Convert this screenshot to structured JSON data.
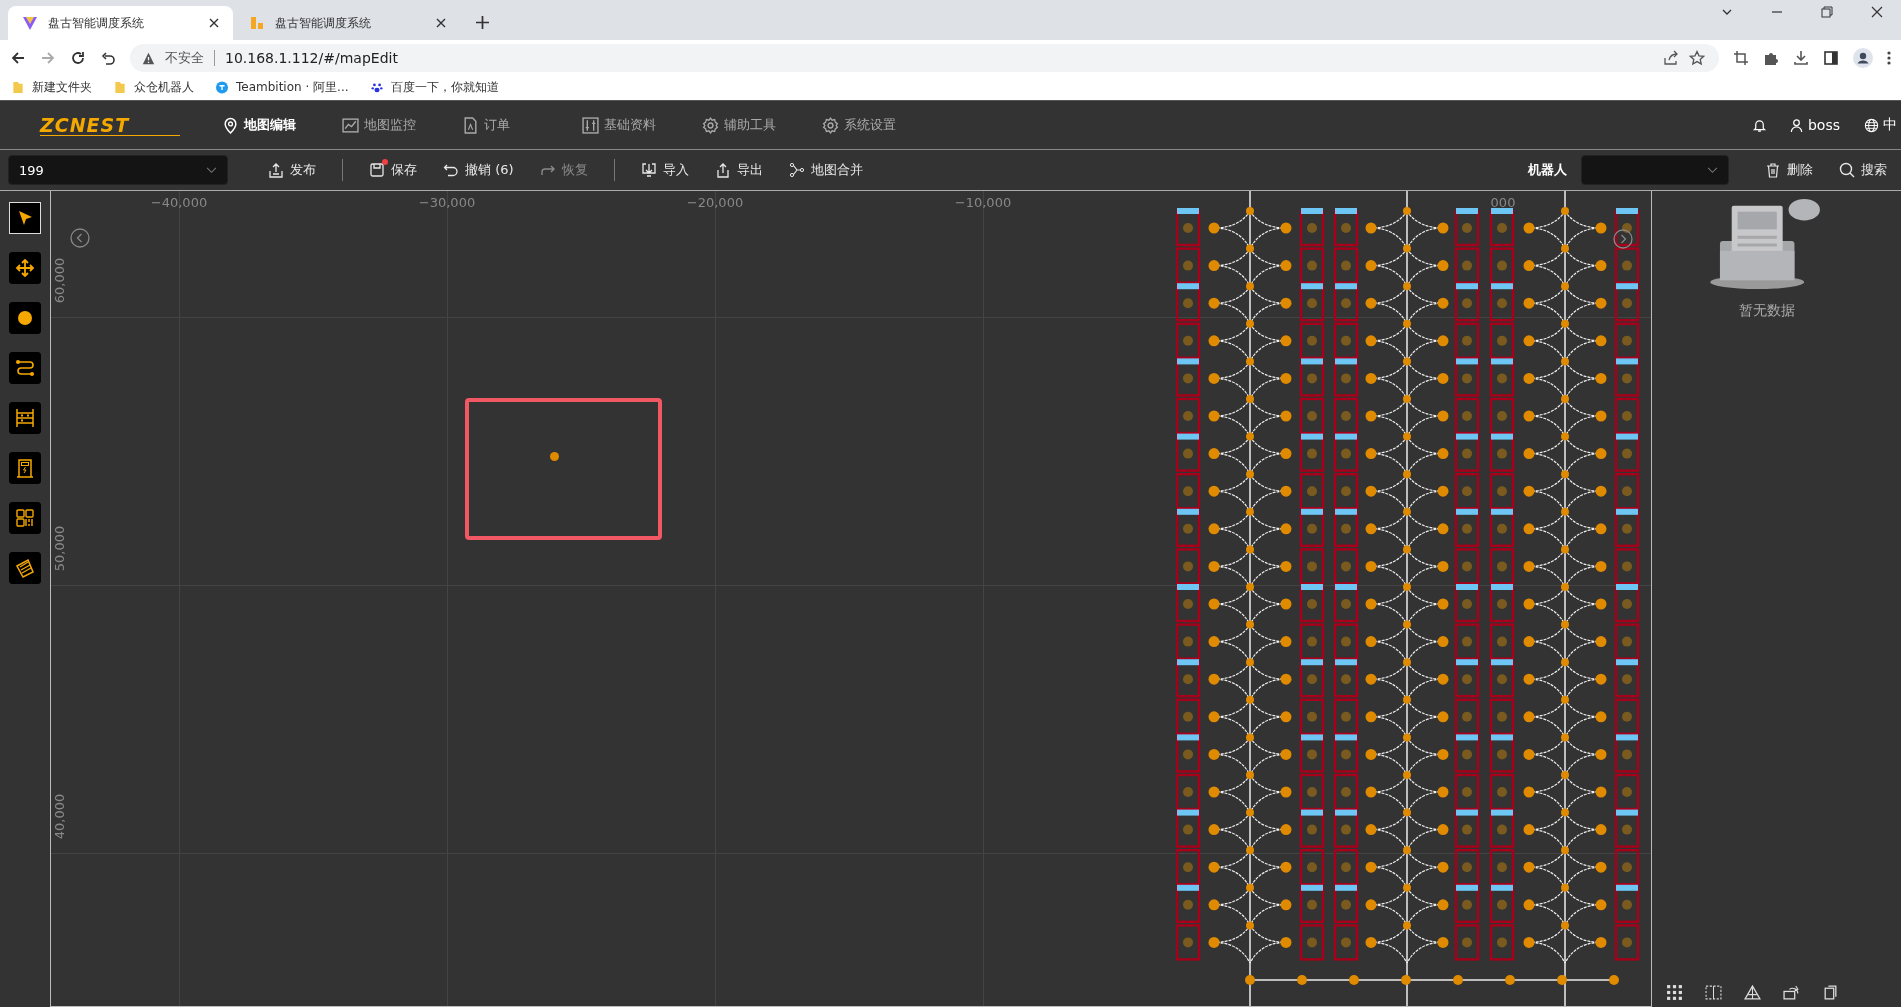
{
  "browser": {
    "tabs": [
      {
        "title": "盘古智能调度系统",
        "selected": true
      },
      {
        "title": "盘古智能调度系统",
        "selected": false
      }
    ],
    "address": {
      "security": "不安全",
      "url": "10.168.1.112/#/mapEdit"
    },
    "bookmarks": [
      "新建文件夹",
      "众仓机器人",
      "Teambition · 阿里...",
      "百度一下，你就知道"
    ]
  },
  "header": {
    "logo": "ZCNEST",
    "nav": [
      {
        "label": "地图编辑",
        "selected": true
      },
      {
        "label": "地图监控",
        "selected": false
      },
      {
        "label": "订单",
        "selected": false
      },
      {
        "label": "基础资料",
        "selected": false
      },
      {
        "label": "辅助工具",
        "selected": false
      },
      {
        "label": "系统设置",
        "selected": false
      }
    ],
    "user": "boss",
    "language": "中"
  },
  "toolbar": {
    "map_select": {
      "value": "199"
    },
    "actions": [
      {
        "label": "发布",
        "disabled": false,
        "unsaved": false
      },
      {
        "label": "保存",
        "disabled": false,
        "unsaved": true
      },
      {
        "label": "撤销 (6)",
        "disabled": false,
        "unsaved": false
      },
      {
        "label": "恢复",
        "disabled": true,
        "unsaved": false
      },
      {
        "label": "导入",
        "disabled": false,
        "unsaved": false
      },
      {
        "label": "导出",
        "disabled": false,
        "unsaved": false
      },
      {
        "label": "地图合并",
        "disabled": false,
        "unsaved": false
      }
    ],
    "robot_label": "机器人",
    "delete": "删除",
    "search": "搜索"
  },
  "tools": [
    {
      "selected": true
    },
    {
      "selected": false
    },
    {
      "selected": false
    },
    {
      "selected": false
    },
    {
      "selected": false
    },
    {
      "selected": false
    },
    {
      "selected": false
    },
    {
      "selected": false
    }
  ],
  "canvas": {
    "x_ticks": [
      "−40,000",
      "−30,000",
      "−20,000",
      "−10,000",
      "000"
    ],
    "y_ticks": [
      "60,000",
      "50,000",
      "40,000"
    ]
  },
  "side_panel": {
    "empty_text": "暂无数据"
  }
}
